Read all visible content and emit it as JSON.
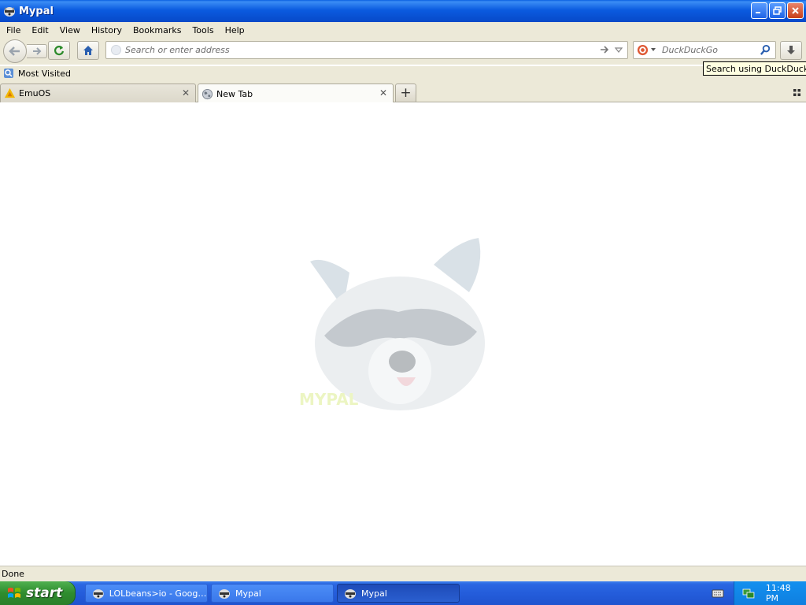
{
  "window": {
    "title": "Mypal"
  },
  "menu": {
    "items": [
      "File",
      "Edit",
      "View",
      "History",
      "Bookmarks",
      "Tools",
      "Help"
    ]
  },
  "navbar": {
    "url_placeholder": "Search or enter address",
    "search_placeholder": "DuckDuckGo",
    "search_tooltip": "Search using DuckDuckGo"
  },
  "bookmarks": {
    "items": [
      {
        "label": "Most Visited",
        "icon": "bookmarks-folder-icon"
      }
    ]
  },
  "tabs": [
    {
      "label": "EmuOS",
      "icon": "emuos-favicon-icon",
      "active": false
    },
    {
      "label": "New Tab",
      "icon": "globe-icon",
      "active": true
    }
  ],
  "status": {
    "text": "Done"
  },
  "taskbar": {
    "start_label": "start",
    "tasks": [
      {
        "label": "LOLbeans>io - Googl...",
        "active": false
      },
      {
        "label": "Mypal",
        "active": false
      },
      {
        "label": "Mypal",
        "active": true
      }
    ],
    "clock": "11:48 PM"
  },
  "colors": {
    "titlebar": "#0b5be0",
    "chrome": "#ece9d8",
    "taskbar": "#245ddb",
    "start": "#2e8c2e"
  }
}
